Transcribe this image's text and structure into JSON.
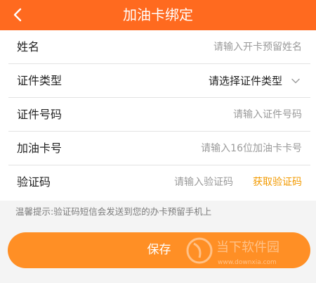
{
  "header": {
    "title": "加油卡绑定",
    "back_icon": "chevron-left-icon"
  },
  "form": {
    "rows": [
      {
        "label": "姓名",
        "placeholder": "请输入开卡预留姓名"
      },
      {
        "label": "证件类型",
        "value": "请选择证件类型",
        "icon": "chevron-down-icon"
      },
      {
        "label": "证件号码",
        "placeholder": "请输入证件号码"
      },
      {
        "label": "加油卡号",
        "placeholder": "请输入16位加油卡卡号"
      },
      {
        "label": "验证码",
        "placeholder": "请输入验证码",
        "action": "获取验证码"
      }
    ]
  },
  "tip": "温馨提示:验证码短信会发送到您的办卡预留手机上",
  "save_button": {
    "label": "保存"
  },
  "watermark": {
    "text": "当下软件园",
    "subtext": "www.downxia.com"
  },
  "colors": {
    "header": "#ff6a1f",
    "button": "#ff8f25",
    "link": "#f29a00"
  }
}
